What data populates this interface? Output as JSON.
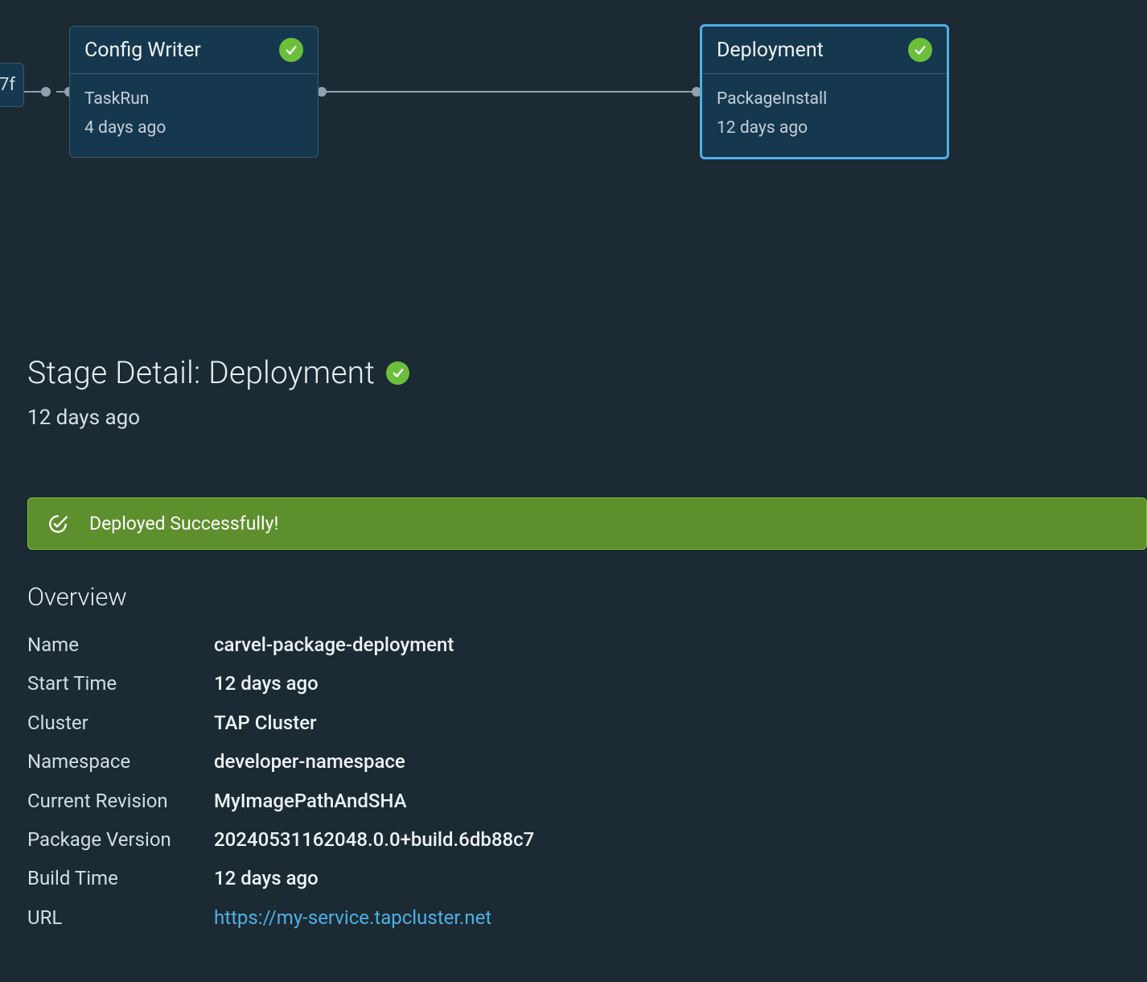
{
  "graph": {
    "partialNode": {
      "labelSuffix": "7f"
    },
    "nodes": [
      {
        "title": "Config Writer",
        "kind": "TaskRun",
        "age": "4 days ago",
        "status": "success",
        "selected": false
      },
      {
        "title": "Deployment",
        "kind": "PackageInstall",
        "age": "12 days ago",
        "status": "success",
        "selected": true
      }
    ]
  },
  "detail": {
    "titlePrefix": "Stage Detail: ",
    "titleStage": "Deployment",
    "age": "12 days ago",
    "banner": {
      "message": "Deployed Successfully!"
    }
  },
  "overview": {
    "heading": "Overview",
    "rows": [
      {
        "label": "Name",
        "value": "carvel-package-deployment",
        "link": false
      },
      {
        "label": "Start Time",
        "value": "12 days ago",
        "link": false
      },
      {
        "label": "Cluster",
        "value": "TAP Cluster",
        "link": false
      },
      {
        "label": "Namespace",
        "value": "developer-namespace",
        "link": false
      },
      {
        "label": "Current Revision",
        "value": "MyImagePathAndSHA",
        "link": false
      },
      {
        "label": "Package Version",
        "value": "20240531162048.0.0+build.6db88c7",
        "link": false
      },
      {
        "label": "Build Time",
        "value": "12 days ago",
        "link": false
      },
      {
        "label": "URL",
        "value": "https://my-service.tapcluster.net",
        "link": true
      }
    ]
  }
}
